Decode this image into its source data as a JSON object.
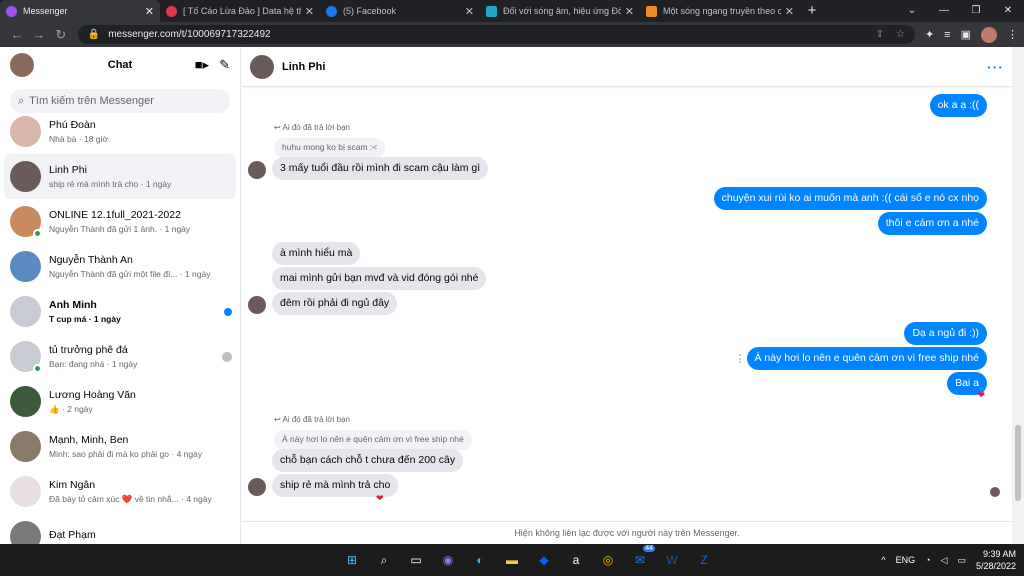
{
  "browser": {
    "tabs": [
      {
        "label": "Messenger",
        "color": "#a04ff5"
      },
      {
        "label": "[ Tố Cáo Lừa Đảo ] Data hệ thống",
        "color": "#e4344a"
      },
      {
        "label": "(5) Facebook",
        "color": "#1877f2"
      },
      {
        "label": "Đối với sóng âm, hiệu ứng Đốp-p",
        "color": "#1ea7c6"
      },
      {
        "label": "Một sóng ngang truyền theo chi",
        "color": "#f08a24"
      }
    ],
    "url": "messenger.com/t/100069717322492"
  },
  "sidebar": {
    "title": "Chat",
    "search_placeholder": "Tìm kiếm trên Messenger",
    "conversations": [
      {
        "name": "Phú Đoàn",
        "preview": "Nhà bà · 18 giờ",
        "bold": false,
        "online": false,
        "active": false,
        "color": "#d8b8a8"
      },
      {
        "name": "Linh Phi",
        "preview": "ship rẻ mà mình trả cho · 1 ngày",
        "bold": false,
        "online": false,
        "active": true,
        "color": "#6a5a5a"
      },
      {
        "name": "ONLINE 12.1full_2021-2022",
        "preview": "Nguyễn Thành đã gửi 1 ảnh. · 1 ngày",
        "bold": false,
        "online": true,
        "active": false,
        "color": "#c98a5c"
      },
      {
        "name": "Nguyễn Thành An",
        "preview": "Nguyễn Thành đã gửi một file đí... · 1 ngày",
        "bold": false,
        "online": false,
        "active": false,
        "color": "#5a8ac0"
      },
      {
        "name": "Anh Minh",
        "preview": "T cup má · 1 ngày",
        "bold": true,
        "online": false,
        "active": false,
        "color": "#c8ccd2"
      },
      {
        "name": "tủ trưởng phê đá",
        "preview": "Bạn: đang nhà · 1 ngày",
        "bold": false,
        "online": true,
        "active": false,
        "color": "#c8ccd2"
      },
      {
        "name": "Lương Hoàng Văn",
        "preview": "👍 · 2 ngày",
        "bold": false,
        "online": false,
        "active": false,
        "color": "#3a5a3a"
      },
      {
        "name": "Mạnh, Minh, Ben",
        "preview": "Minh: sao phải đi mà ko phải go · 4 ngày",
        "bold": false,
        "online": false,
        "active": false,
        "color": "#8a7a6a"
      },
      {
        "name": "Kim Ngân",
        "preview": "Đã bày tỏ cảm xúc ❤️ về tin nhắ... · 4 ngày",
        "bold": false,
        "online": false,
        "active": false,
        "color": "#e8e0e0"
      },
      {
        "name": "Đạt Phạm",
        "preview": "",
        "bold": false,
        "online": false,
        "active": false,
        "color": "#7a7a7a"
      }
    ]
  },
  "chat": {
    "contact_name": "Linh Phi",
    "footer": "Hiện không liên lạc được với người này trên Messenger.",
    "reply_hint": "Ai đó đã trả lời bạn",
    "messages": [
      {
        "text": "ok a ạ :((",
        "dir": "out"
      },
      {
        "text": "huhu mong ko bị scam :<",
        "dir": "quote"
      },
      {
        "text": "3 mấy tuổi đầu rồi mình đi scam cậu làm gì",
        "dir": "in"
      },
      {
        "text": "chuyện xui rùi ko ai muốn mà anh :(( cái số e nó cx nhọ",
        "dir": "out"
      },
      {
        "text": "thôi e cám ơn a nhé",
        "dir": "out"
      },
      {
        "text": "à mình hiểu mà",
        "dir": "in"
      },
      {
        "text": "mai mình gửi bạn mvđ và vid đóng gói nhé",
        "dir": "in"
      },
      {
        "text": "đêm rồi phải đi ngủ đây",
        "dir": "in"
      },
      {
        "text": "Dạ a ngủ đi :))",
        "dir": "out"
      },
      {
        "text": "À này hơi lo nên e quên cảm ơn vì free ship nhé",
        "dir": "out"
      },
      {
        "text": "Bai a",
        "dir": "out"
      },
      {
        "text": "À này hơi lo nên e quên cảm ơn vì free ship nhé",
        "dir": "quote"
      },
      {
        "text": "chỗ bạn cách chỗ t chưa đến 200 cây",
        "dir": "in"
      },
      {
        "text": "ship rẻ mà mình trả cho",
        "dir": "in"
      }
    ]
  },
  "taskbar": {
    "lang": "ENG",
    "time": "9:39 AM",
    "date": "5/28/2022",
    "badge": "44"
  }
}
